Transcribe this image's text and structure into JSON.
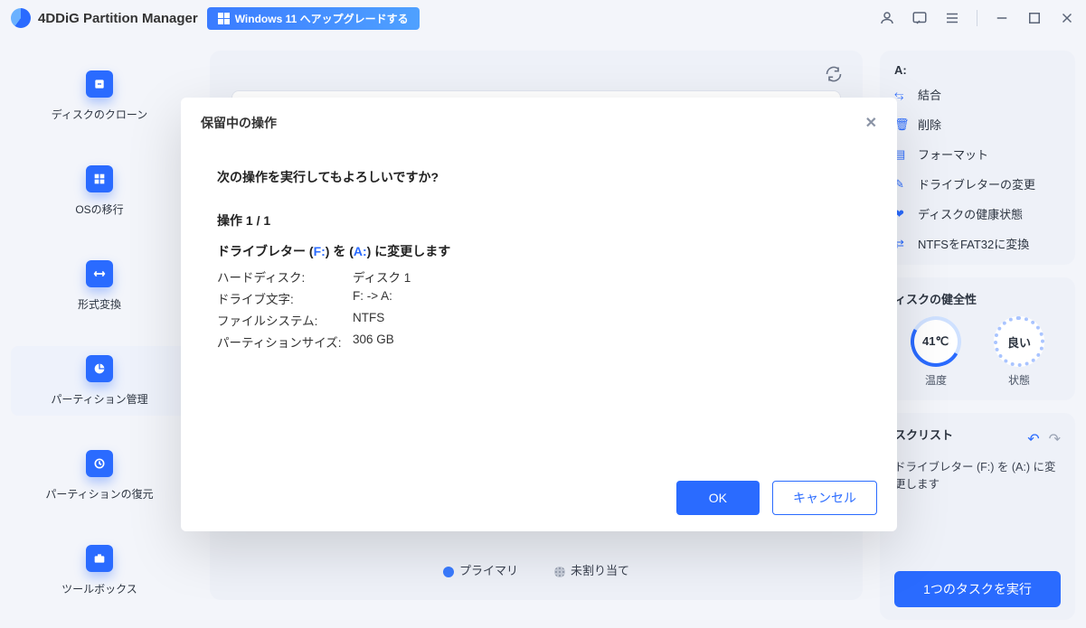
{
  "titlebar": {
    "app_name": "4DDiG Partition Manager",
    "upgrade_label": "Windows 11 へアップグレードする"
  },
  "sidebar": {
    "items": [
      {
        "label": "ディスクのクローン"
      },
      {
        "label": "OSの移行"
      },
      {
        "label": "形式変換"
      },
      {
        "label": "パーティション管理"
      },
      {
        "label": "パーティションの復元"
      },
      {
        "label": "ツールボックス"
      }
    ]
  },
  "legend": {
    "primary": "プライマリ",
    "unallocated": "未割り当て"
  },
  "right": {
    "drive_header": "A:",
    "actions": [
      "結合",
      "削除",
      "フォーマット",
      "ドライブレターの変更",
      "ディスクの健康状態",
      "NTFSをFAT32に変換"
    ],
    "health_title": "ィスクの健全性",
    "temp_value": "41℃",
    "state_value": "良い",
    "temp_label": "温度",
    "state_label": "状態",
    "tasklist_title": "スクリスト",
    "task_desc": "ドライブレター (F:) を (A:) に変更します",
    "run_button": "1つのタスクを実行"
  },
  "modal": {
    "title": "保留中の操作",
    "confirm_question": "次の操作を実行してもよろしいですか?",
    "op_counter": "操作 1 / 1",
    "op_desc_pre": "ドライブレター (",
    "op_desc_from": "F:",
    "op_desc_mid": ") を (",
    "op_desc_to": "A:",
    "op_desc_post": ") に変更します",
    "rows": {
      "hard_disk_k": "ハードディスク:",
      "hard_disk_v": "ディスク 1",
      "drive_letter_k": "ドライブ文字:",
      "drive_letter_v": "F: -> A:",
      "fs_k": "ファイルシステム:",
      "fs_v": "NTFS",
      "size_k": "パーティションサイズ:",
      "size_v": "306 GB"
    },
    "ok": "OK",
    "cancel": "キャンセル"
  }
}
